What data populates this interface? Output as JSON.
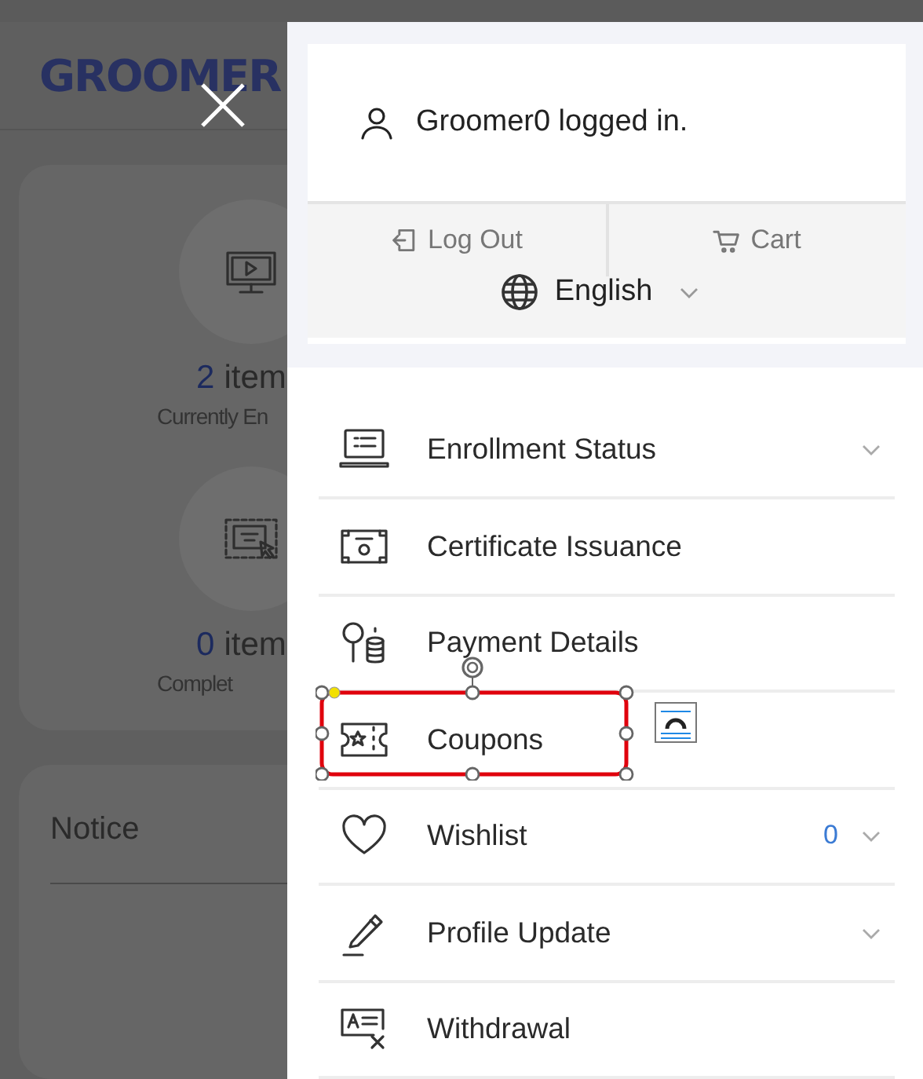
{
  "background": {
    "logo": "GROOMER",
    "stats": [
      {
        "kind": "monitor",
        "count": "2",
        "unit": "item",
        "label": "Currently En"
      },
      {
        "kind": "certificate",
        "count": "0",
        "unit": "item",
        "label": "Complet"
      }
    ],
    "notice_title": "Notice"
  },
  "account": {
    "user_text": "Groomer0 logged in.",
    "actions": [
      {
        "kind": "logout",
        "label": "Log Out"
      },
      {
        "kind": "cart",
        "label": "Cart"
      }
    ],
    "language": "English"
  },
  "menu": [
    {
      "kind": "enrollment",
      "label": "Enrollment Status",
      "expandable": true,
      "highlighted": false
    },
    {
      "kind": "certificate",
      "label": "Certificate Issuance",
      "expandable": false,
      "highlighted": false
    },
    {
      "kind": "payment",
      "label": "Payment Details",
      "expandable": false,
      "highlighted": false
    },
    {
      "kind": "coupon",
      "label": "Coupons",
      "expandable": false,
      "highlighted": true
    },
    {
      "kind": "wishlist",
      "label": "Wishlist",
      "count": "0",
      "expandable": true,
      "highlighted": false
    },
    {
      "kind": "profile",
      "label": "Profile Update",
      "expandable": true,
      "highlighted": false
    },
    {
      "kind": "withdrawal",
      "label": "Withdrawal",
      "expandable": false,
      "highlighted": false
    }
  ]
}
